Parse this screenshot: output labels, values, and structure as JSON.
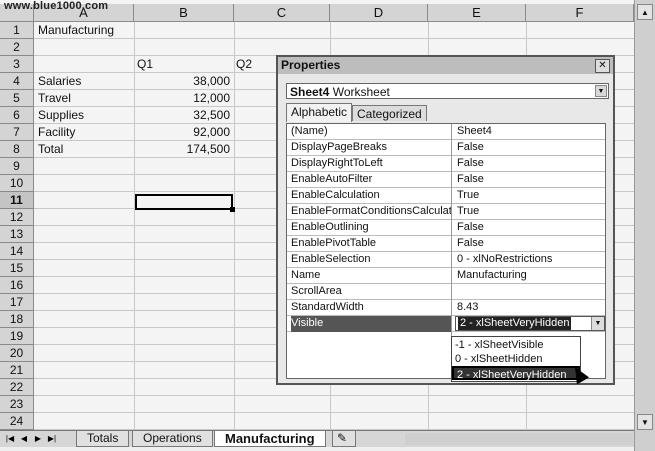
{
  "watermark": "www.blue1000.com",
  "columns": [
    "A",
    "B",
    "C",
    "D",
    "E",
    "F"
  ],
  "rows": [
    "1",
    "2",
    "3",
    "4",
    "5",
    "6",
    "7",
    "8",
    "9",
    "10",
    "11",
    "12",
    "13",
    "14",
    "15",
    "16",
    "17",
    "18",
    "19",
    "20",
    "21",
    "22",
    "23",
    "24"
  ],
  "cells": {
    "a1": "Manufacturing",
    "b3": "Q1",
    "c3": "Q2",
    "a4": "Salaries",
    "b4": "38,000",
    "a5": "Travel",
    "b5": "12,000",
    "a6": "Supplies",
    "b6": "32,500",
    "a7": "Facility",
    "b7": "92,000",
    "a8": "Total",
    "b8": "174,500"
  },
  "sheet_tabs": [
    "Totals",
    "Operations",
    "Manufacturing"
  ],
  "properties": {
    "title": "Properties",
    "object_name": "Sheet4",
    "object_type": "Worksheet",
    "tabs": [
      "Alphabetic",
      "Categorized"
    ],
    "items": [
      {
        "name": "(Name)",
        "value": "Sheet4"
      },
      {
        "name": "DisplayPageBreaks",
        "value": "False"
      },
      {
        "name": "DisplayRightToLeft",
        "value": "False"
      },
      {
        "name": "EnableAutoFilter",
        "value": "False"
      },
      {
        "name": "EnableCalculation",
        "value": "True"
      },
      {
        "name": "EnableFormatConditionsCalculati",
        "value": "True"
      },
      {
        "name": "EnableOutlining",
        "value": "False"
      },
      {
        "name": "EnablePivotTable",
        "value": "False"
      },
      {
        "name": "EnableSelection",
        "value": "0 - xlNoRestrictions"
      },
      {
        "name": "Name",
        "value": "Manufacturing"
      },
      {
        "name": "ScrollArea",
        "value": ""
      },
      {
        "name": "StandardWidth",
        "value": "8.43"
      },
      {
        "name": "Visible",
        "value": "2 - xlSheetVeryHidden"
      }
    ],
    "visible_options": [
      "-1 - xlSheetVisible",
      "0 - xlSheetHidden",
      "2 - xlSheetVeryHidden"
    ]
  }
}
